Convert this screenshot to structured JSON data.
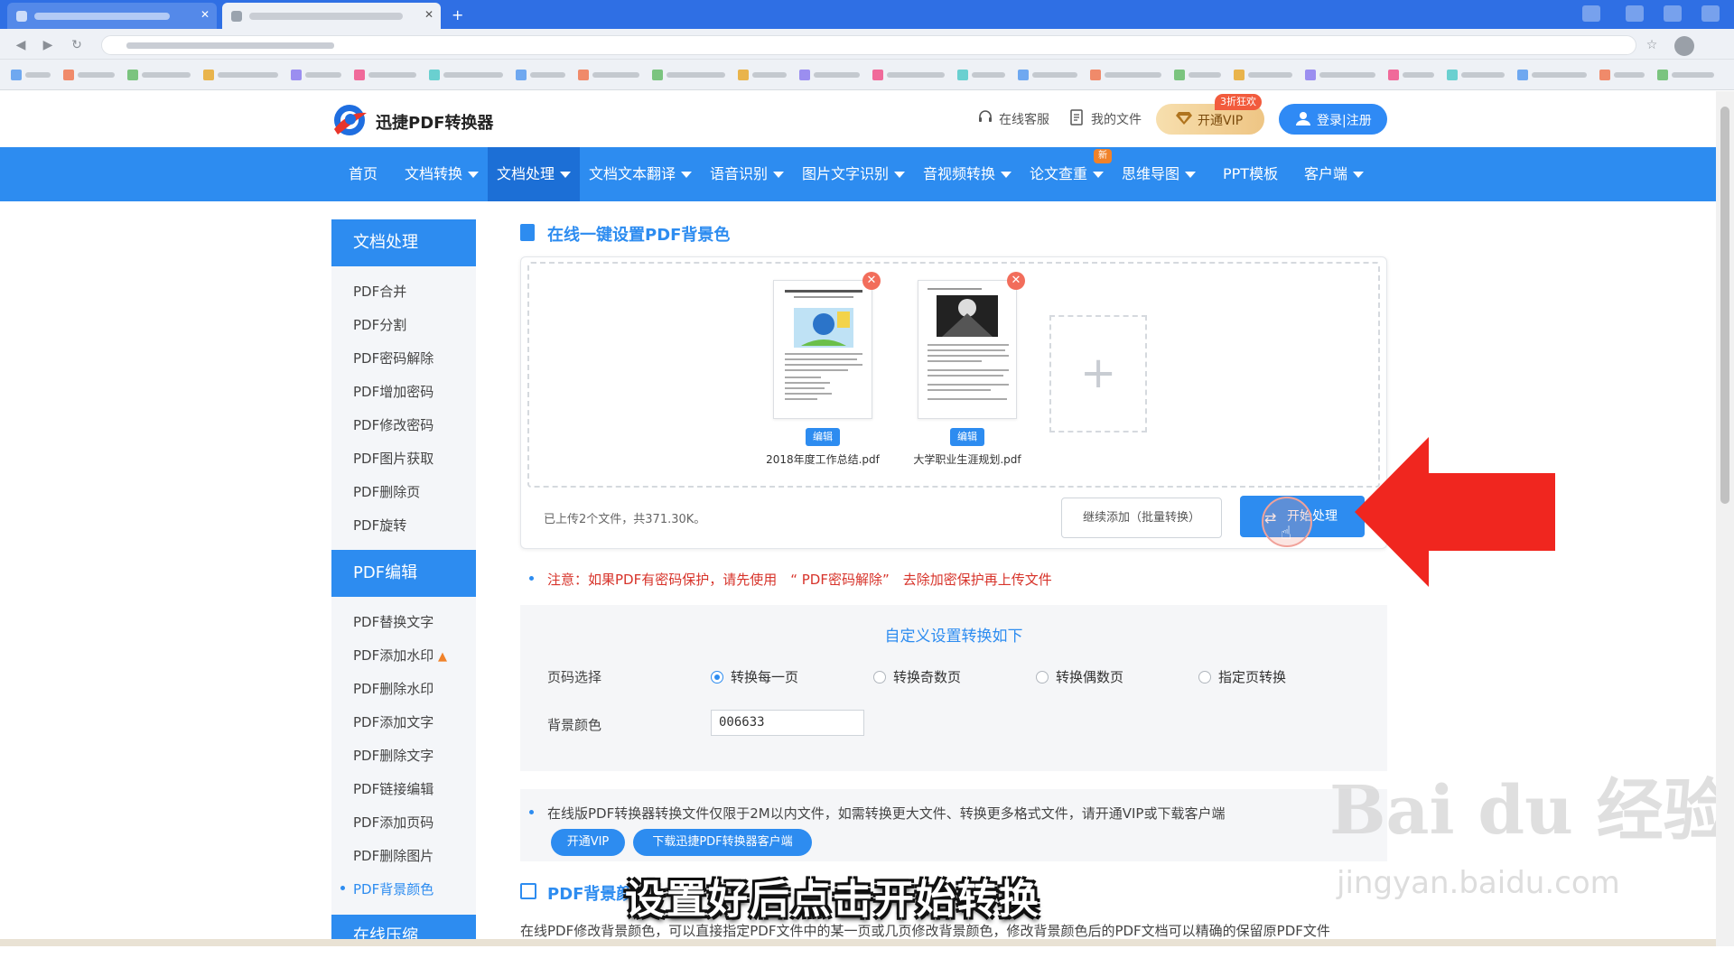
{
  "site": {
    "name": "迅捷PDF转换器",
    "support": "在线客服",
    "my_files": "我的文件",
    "vip_button": "开通VIP",
    "vip_badge": "3折狂欢",
    "login": "登录|注册",
    "new_badge": "新"
  },
  "nav": {
    "items": [
      {
        "label": "首页",
        "dropdown": false
      },
      {
        "label": "文档转换",
        "dropdown": true
      },
      {
        "label": "文档处理",
        "dropdown": true,
        "active": true
      },
      {
        "label": "文档文本翻译",
        "dropdown": true
      },
      {
        "label": "语音识别",
        "dropdown": true
      },
      {
        "label": "图片文字识别",
        "dropdown": true
      },
      {
        "label": "音视频转换",
        "dropdown": true
      },
      {
        "label": "论文查重",
        "dropdown": true
      },
      {
        "label": "思维导图",
        "dropdown": true
      },
      {
        "label": "PPT模板",
        "dropdown": false
      },
      {
        "label": "客户端",
        "dropdown": true
      }
    ]
  },
  "sidebar": {
    "groups": [
      {
        "title": "文档处理",
        "items": [
          "PDF合并",
          "PDF分割",
          "PDF密码解除",
          "PDF增加密码",
          "PDF修改密码",
          "PDF图片获取",
          "PDF删除页",
          "PDF旋转"
        ]
      },
      {
        "title": "PDF编辑",
        "items": [
          "PDF替换文字",
          "PDF添加水印",
          "PDF删除水印",
          "PDF添加文字",
          "PDF删除文字",
          "PDF链接编辑",
          "PDF添加页码",
          "PDF删除图片",
          "PDF背景颜色"
        ]
      },
      {
        "title": "在线压缩",
        "items": []
      }
    ],
    "active_item": "PDF背景颜色"
  },
  "main": {
    "title": "在线一键设置PDF背景色",
    "files": [
      {
        "name": "2018年度工作总结.pdf",
        "edit": "编辑"
      },
      {
        "name": "大学职业生涯规划.pdf",
        "edit": "编辑"
      }
    ],
    "status": "已上传2个文件，共371.30K。",
    "continue_button": "继续添加（批量转换）",
    "start_button": "开始处理",
    "note": "注意：如果PDF有密码保护，请先使用　“ PDF密码解除”　去除加密保护再上传文件",
    "settings": {
      "title": "自定义设置转换如下",
      "page_label": "页码选择",
      "options": [
        "转换每一页",
        "转换奇数页",
        "转换偶数页",
        "指定页转换"
      ],
      "selected_option": "转换每一页",
      "color_label": "背景颜色",
      "color_value": "006633"
    },
    "info": {
      "text": "在线版PDF转换器转换文件仅限于2M以内文件，如需转换更大文件、转换更多格式文件，请开通VIP或下载客户端",
      "vip_button": "开通VIP",
      "download_button": "下载迅捷PDF转换器客户端"
    },
    "section2_title": "PDF背景颜",
    "description": "在线PDF修改背景颜色，可以直接指定PDF文件中的某一页或几页修改背景颜色，修改背景颜色后的PDF文档可以精确的保留原PDF文件"
  },
  "overlay": {
    "caption": "设置好后点击开始转换",
    "watermark_logo": "Bai du 经验",
    "watermark_url": "jingyan.baidu.com"
  },
  "colors": {
    "primary": "#2d8cf0",
    "nav_active": "#1c6fd6",
    "note_red": "#d7332a",
    "arrow_red": "#f0261f",
    "vip_gold": "#eec584"
  }
}
